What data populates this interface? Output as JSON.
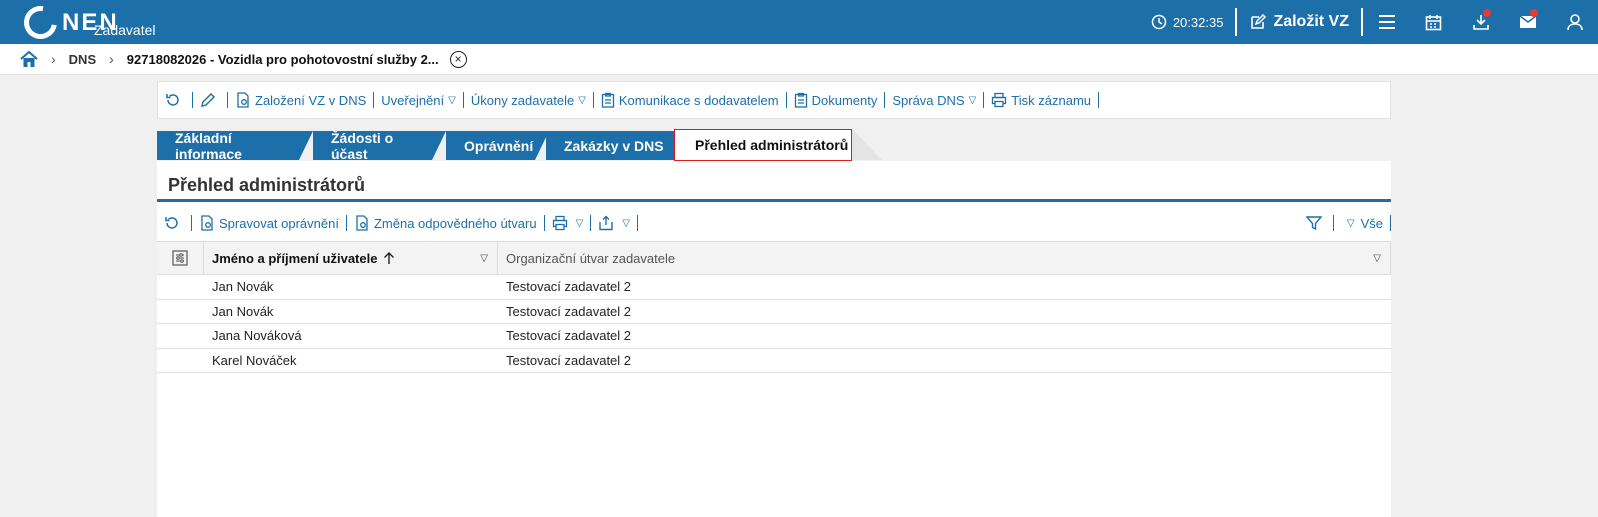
{
  "header": {
    "logo_text": "NEN",
    "logo_sub": "Zadavatel",
    "clock": "20:32:35",
    "create_label": "Založit VZ"
  },
  "breadcrumb": {
    "items": [
      "DNS",
      "92718082026 - Vozidla pro pohotovostní služby 2..."
    ]
  },
  "toolbar": {
    "items": [
      "Založení VZ v DNS",
      "Uveřejnění",
      "Úkony zadavatele",
      "Komunikace s dodavatelem",
      "Dokumenty",
      "Správa DNS",
      "Tisk záznamu"
    ]
  },
  "tabs": [
    "Základní informace",
    "Žádosti o účast",
    "Oprávnění",
    "Zakázky v DNS",
    "Přehled administrátorů"
  ],
  "panel": {
    "title": "Přehled administrátorů",
    "actions": [
      "Spravovat oprávnění",
      "Změna odpovědného útvaru"
    ],
    "filter_label": "Vše"
  },
  "grid": {
    "columns": [
      "Jméno a příjmení uživatele",
      "Organizační útvar zadavatele"
    ],
    "rows": [
      [
        "Jan Novák",
        "Testovací zadavatel 2"
      ],
      [
        "Jan Novák",
        "Testovací zadavatel 2"
      ],
      [
        "Jana Nováková",
        "Testovací zadavatel 2"
      ],
      [
        "Karel Nováček",
        "Testovací zadavatel 2"
      ]
    ]
  },
  "colors": {
    "brand": "#1c6fa9",
    "active_tab_border": "#e0191e",
    "notification": "#e53935"
  }
}
